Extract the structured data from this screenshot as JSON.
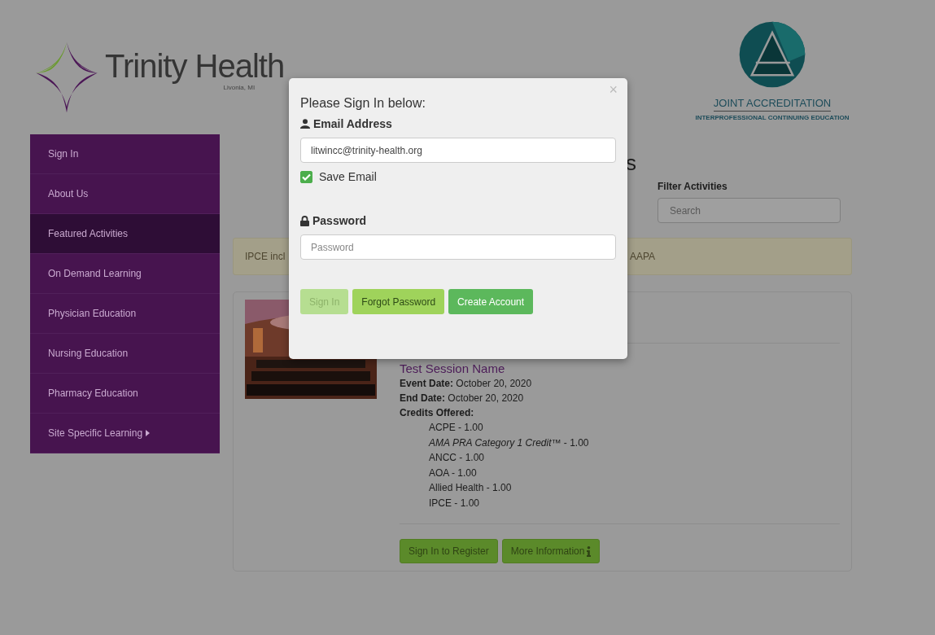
{
  "header": {
    "logo_text": "Trinity Health",
    "logo_location": "Livonia, MI",
    "accreditation_title": "JOINT ACCREDITATION",
    "accreditation_subtitle": "INTERPROFESSIONAL CONTINUING EDUCATION"
  },
  "sidebar": {
    "items": [
      {
        "label": "Sign In",
        "selected": false,
        "has_submenu": false
      },
      {
        "label": "About Us",
        "selected": false,
        "has_submenu": false
      },
      {
        "label": "Featured Activities",
        "selected": true,
        "has_submenu": false
      },
      {
        "label": "On Demand Learning",
        "selected": false,
        "has_submenu": false
      },
      {
        "label": "Physician Education",
        "selected": false,
        "has_submenu": false
      },
      {
        "label": "Nursing Education",
        "selected": false,
        "has_submenu": false
      },
      {
        "label": "Pharmacy Education",
        "selected": false,
        "has_submenu": false
      },
      {
        "label": "Site Specific Learning",
        "selected": false,
        "has_submenu": true
      }
    ]
  },
  "main": {
    "heading_visible": "s",
    "filter": {
      "label": "Filter Activities",
      "placeholder": "Search"
    },
    "alert": {
      "text_start": "IPCE incl",
      "text_end": "AAPA"
    },
    "activity": {
      "kind": "picture",
      "title": "Test Session Name",
      "details": [
        {
          "label": "Event Date:",
          "value": "October 20, 2020"
        },
        {
          "label": "End Date:",
          "value": "October 20, 2020"
        },
        {
          "label": "Credits Offered:"
        }
      ],
      "credits": [
        "ACPE - 1.00",
        "*AMA PRA Category 1 Credit™* - 1.00",
        "ANCC - 1.00",
        "AOA - 1.00",
        "Allied Health - 1.00",
        "IPCE - 1.00"
      ],
      "buttons": [
        {
          "label": "Sign In to Register",
          "has_info_icon": false
        },
        {
          "label": "More Information",
          "has_info_icon": true
        }
      ]
    }
  },
  "modal": {
    "close": "×",
    "title": "Please Sign In below:",
    "email_label": "Email Address",
    "email_value": "litwincc@trinity-health.org",
    "save_email": {
      "label": "Save Email",
      "checked": true
    },
    "password_label": "Password",
    "password_placeholder": "Password",
    "buttons": [
      {
        "label": "Sign In",
        "kind": "disabled"
      },
      {
        "label": "Forgot Password",
        "kind": "light"
      },
      {
        "label": "Create Account",
        "kind": "primary"
      }
    ]
  }
}
